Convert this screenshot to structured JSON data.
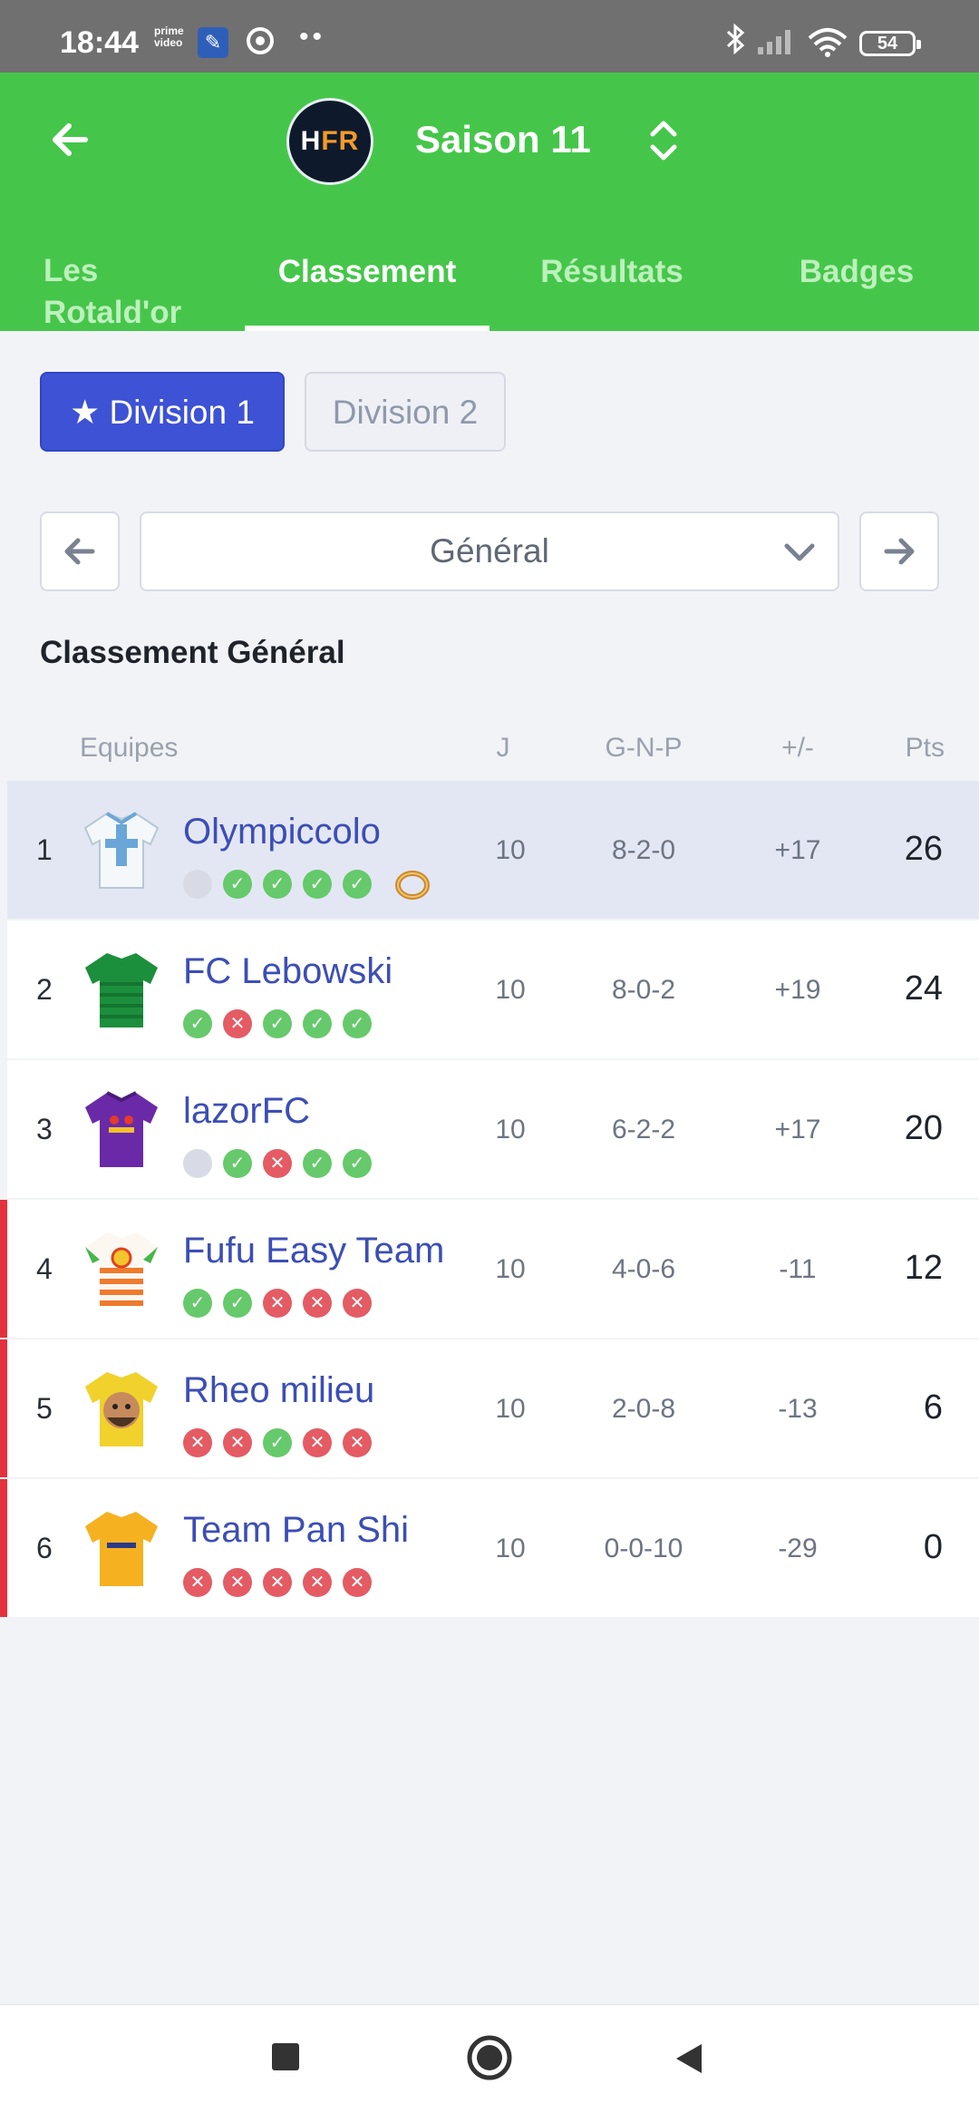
{
  "status_bar": {
    "time": "18:44",
    "prime_label": "prime\nvideo",
    "battery": "54",
    "icons": [
      "prime-video-icon",
      "tool-icon",
      "chrome-icon",
      "more-dots-icon",
      "bluetooth-icon",
      "signal-icon",
      "wifi-icon",
      "battery-icon"
    ]
  },
  "header": {
    "logo_text_a": "H",
    "logo_text_b": "FR",
    "season": "Saison 11",
    "accent_color": "#45c64a"
  },
  "tabs": [
    {
      "label": "Les Rotald'or",
      "active": false
    },
    {
      "label": "Classement",
      "active": true
    },
    {
      "label": "Résultats",
      "active": false
    },
    {
      "label": "Badges",
      "active": false
    }
  ],
  "divisions": [
    {
      "label": "★ Division 1",
      "active": true
    },
    {
      "label": "Division 2",
      "active": false
    }
  ],
  "selector": {
    "value": "Général"
  },
  "section_title": "Classement Général",
  "table": {
    "headers": {
      "team": "Equipes",
      "j": "J",
      "gnp": "G-N-P",
      "diff": "+/-",
      "pts": "Pts"
    },
    "rows": [
      {
        "rank": "1",
        "name": "Olympiccolo",
        "j": "10",
        "gnp": "8-2-0",
        "diff": "+17",
        "pts": "26",
        "form": [
          "n",
          "w",
          "w",
          "w",
          "w"
        ],
        "badge": "ring",
        "highlight": true,
        "flag": false
      },
      {
        "rank": "2",
        "name": "FC Lebowski",
        "j": "10",
        "gnp": "8-0-2",
        "diff": "+19",
        "pts": "24",
        "form": [
          "w",
          "l",
          "w",
          "w",
          "w"
        ],
        "highlight": false,
        "flag": false
      },
      {
        "rank": "3",
        "name": "lazorFC",
        "j": "10",
        "gnp": "6-2-2",
        "diff": "+17",
        "pts": "20",
        "form": [
          "n",
          "w",
          "l",
          "w",
          "w"
        ],
        "highlight": false,
        "flag": false
      },
      {
        "rank": "4",
        "name": "Fufu Easy Team",
        "j": "10",
        "gnp": "4-0-6",
        "diff": "-11",
        "pts": "12",
        "form": [
          "w",
          "w",
          "l",
          "l",
          "l"
        ],
        "highlight": false,
        "flag": true
      },
      {
        "rank": "5",
        "name": "Rheo milieu",
        "j": "10",
        "gnp": "2-0-8",
        "diff": "-13",
        "pts": "6",
        "form": [
          "l",
          "l",
          "w",
          "l",
          "l"
        ],
        "highlight": false,
        "flag": true
      },
      {
        "rank": "6",
        "name": "Team Pan Shi",
        "j": "10",
        "gnp": "0-0-10",
        "diff": "-29",
        "pts": "0",
        "form": [
          "l",
          "l",
          "l",
          "l",
          "l"
        ],
        "highlight": false,
        "flag": true
      }
    ]
  },
  "colors": {
    "win": "#66c96b",
    "loss": "#e45b64",
    "none": "#d8dbe6",
    "relegation_flag": "#e3323e",
    "division_active": "#3d52d5",
    "team_name": "#3c4eb5"
  },
  "nav": {
    "icons": [
      "recents-square-icon",
      "home-circle-icon",
      "back-triangle-icon"
    ]
  }
}
